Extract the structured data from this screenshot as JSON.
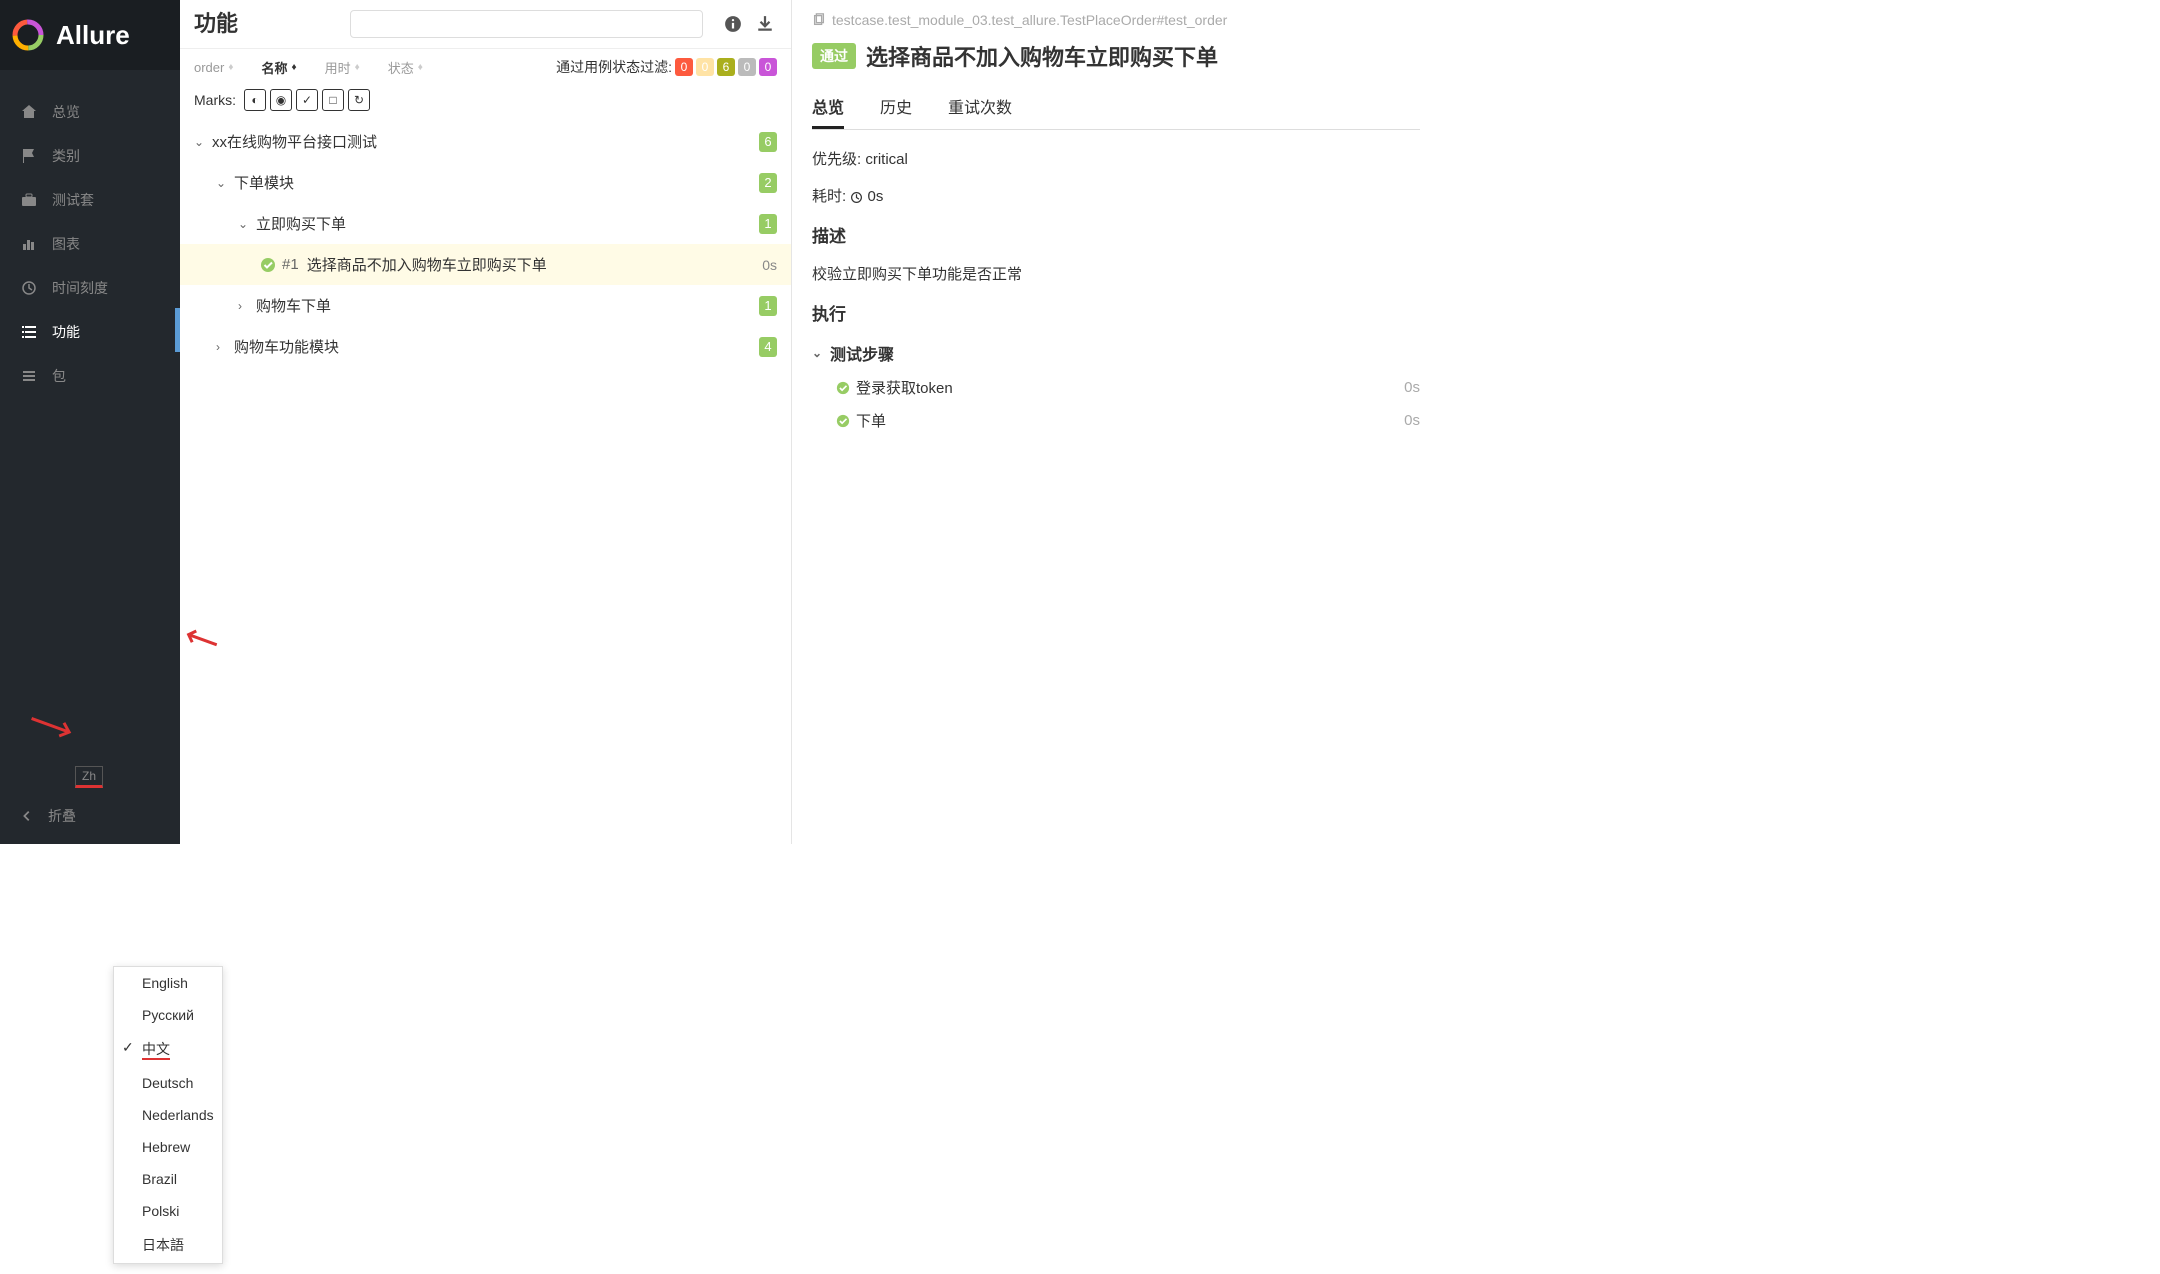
{
  "sidebar": {
    "brand": "Allure",
    "items": [
      {
        "label": "总览"
      },
      {
        "label": "类别"
      },
      {
        "label": "测试套"
      },
      {
        "label": "图表"
      },
      {
        "label": "时间刻度"
      },
      {
        "label": "功能"
      },
      {
        "label": "包"
      }
    ],
    "lang_code": "Zh",
    "collapse_label": "折叠"
  },
  "lang_menu": {
    "items": [
      "English",
      "Русский",
      "中文",
      "Deutsch",
      "Nederlands",
      "Hebrew",
      "Brazil",
      "Polski",
      "日本語"
    ],
    "selected": "中文"
  },
  "middle": {
    "title": "功能",
    "search_placeholder": "",
    "sort_cols": {
      "order": "order",
      "name": "名称",
      "duration": "用时",
      "status": "状态"
    },
    "filter_label": "通过用例状态过滤:",
    "filter_counts": {
      "failed": "0",
      "broken": "0",
      "passed": "6",
      "skipped": "0",
      "unknown": "0"
    },
    "marks_label": "Marks:",
    "tree": [
      {
        "level": 0,
        "type": "group",
        "expanded": true,
        "label": "xx在线购物平台接口测试",
        "badge": "6"
      },
      {
        "level": 1,
        "type": "group",
        "expanded": true,
        "label": "下单模块",
        "badge": "2"
      },
      {
        "level": 2,
        "type": "group",
        "expanded": true,
        "label": "立即购买下单",
        "badge": "1"
      },
      {
        "level": 3,
        "type": "test",
        "selected": true,
        "status": "passed",
        "num": "#1",
        "label": "选择商品不加入购物车立即购买下单",
        "time": "0s"
      },
      {
        "level": 2,
        "type": "group",
        "expanded": false,
        "label": "购物车下单",
        "badge": "1"
      },
      {
        "level": 1,
        "type": "group",
        "expanded": false,
        "label": "购物车功能模块",
        "badge": "4"
      }
    ]
  },
  "detail": {
    "path": "testcase.test_module_03.test_allure.TestPlaceOrder#test_order",
    "status": "通过",
    "title": "选择商品不加入购物车立即购买下单",
    "tabs": [
      "总览",
      "历史",
      "重试次数"
    ],
    "active_tab": "总览",
    "priority_label": "优先级:",
    "priority_value": "critical",
    "duration_label": "耗时:",
    "duration_value": "0s",
    "desc_label": "描述",
    "desc_value": "校验立即购买下单功能是否正常",
    "exec_label": "执行",
    "steps_label": "测试步骤",
    "steps": [
      {
        "name": "登录获取token",
        "time": "0s"
      },
      {
        "name": "下单",
        "time": "0s"
      }
    ]
  }
}
